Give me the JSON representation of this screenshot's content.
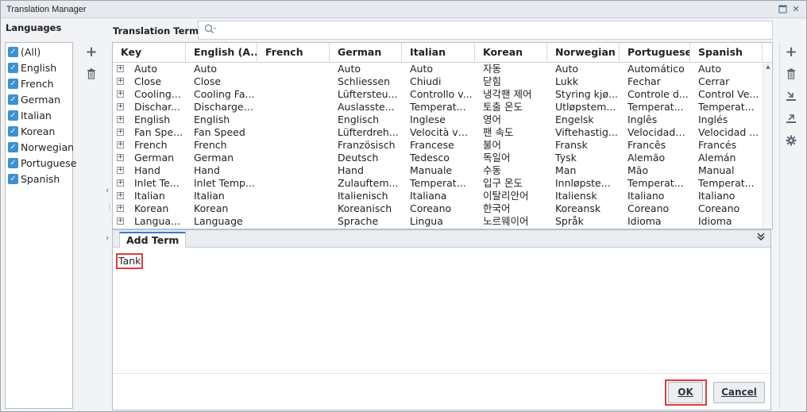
{
  "window": {
    "title": "Translation Manager"
  },
  "languages": {
    "heading": "Languages",
    "items": [
      {
        "label": "(All)",
        "checked": true
      },
      {
        "label": "English",
        "checked": true
      },
      {
        "label": "French",
        "checked": true
      },
      {
        "label": "German",
        "checked": true
      },
      {
        "label": "Italian",
        "checked": true
      },
      {
        "label": "Korean",
        "checked": true
      },
      {
        "label": "Norwegian",
        "checked": true
      },
      {
        "label": "Portuguese",
        "checked": true
      },
      {
        "label": "Spanish",
        "checked": true
      }
    ]
  },
  "terms": {
    "heading": "Translation Terms",
    "search_value": "",
    "columns": [
      "Key",
      "English (A...",
      "French",
      "German",
      "Italian",
      "Korean",
      "Norwegian",
      "Portuguese",
      "Spanish"
    ],
    "rows": [
      [
        "Auto",
        "Auto",
        "",
        "Auto",
        "Auto",
        "자동",
        "Auto",
        "Automático",
        "Auto"
      ],
      [
        "Close",
        "Close",
        "",
        "Schliessen",
        "Chiudi",
        "닫힘",
        "Lukk",
        "Fechar",
        "Cerrar"
      ],
      [
        "Cooling...",
        "Cooling Fa...",
        "",
        "Lüftersteu...",
        "Controllo v...",
        "냉각팬 제어",
        "Styring kjø...",
        "Controle d...",
        "Control Ve..."
      ],
      [
        "Dischar...",
        "Discharge ...",
        "",
        "Auslasste...",
        "Temperat...",
        "토출 온도",
        "Utløpstem...",
        "Temperat...",
        "Temperat..."
      ],
      [
        "English",
        "English",
        "",
        "Englisch",
        "Inglese",
        "영어",
        "Engelsk",
        "Inglês",
        "Inglés"
      ],
      [
        "Fan Spe...",
        "Fan Speed",
        "",
        "Lüfterdreh...",
        "Velocità ve...",
        "팬 속도",
        "Viftehastig...",
        "Velocidade...",
        "Velocidad ..."
      ],
      [
        "French",
        "French",
        "",
        "Französisch",
        "Francese",
        "불어",
        "Fransk",
        "Francês",
        "Francés"
      ],
      [
        "German",
        "German",
        "",
        "Deutsch",
        "Tedesco",
        "독일어",
        "Tysk",
        "Alemão",
        "Alemán"
      ],
      [
        "Hand",
        "Hand",
        "",
        "Hand",
        "Manuale",
        "수동",
        "Man",
        "Mão",
        "Manual"
      ],
      [
        "Inlet Te...",
        "Inlet Temp...",
        "",
        "Zulauftem...",
        "Temperat...",
        "입구 온도",
        "Innløpste...",
        "Temperat...",
        "Temperat..."
      ],
      [
        "Italian",
        "Italian",
        "",
        "Italienisch",
        "Italiana",
        "이탈리안어",
        "Italiensk",
        "Italiano",
        "Italiano"
      ],
      [
        "Korean",
        "Korean",
        "",
        "Koreanisch",
        "Coreano",
        "한국어",
        "Koreansk",
        "Coreano",
        "Coreano"
      ],
      [
        "Langua...",
        "Language",
        "",
        "Sprache",
        "Lingua",
        "노르웨이어",
        "Språk",
        "Idioma",
        "Idioma"
      ]
    ]
  },
  "add_term": {
    "tab_label": "Add Term",
    "value": "Tank",
    "ok_label": "OK",
    "cancel_label": "Cancel"
  },
  "colors": {
    "accent": "#3d8fd6",
    "highlight": "#e03c3c"
  }
}
